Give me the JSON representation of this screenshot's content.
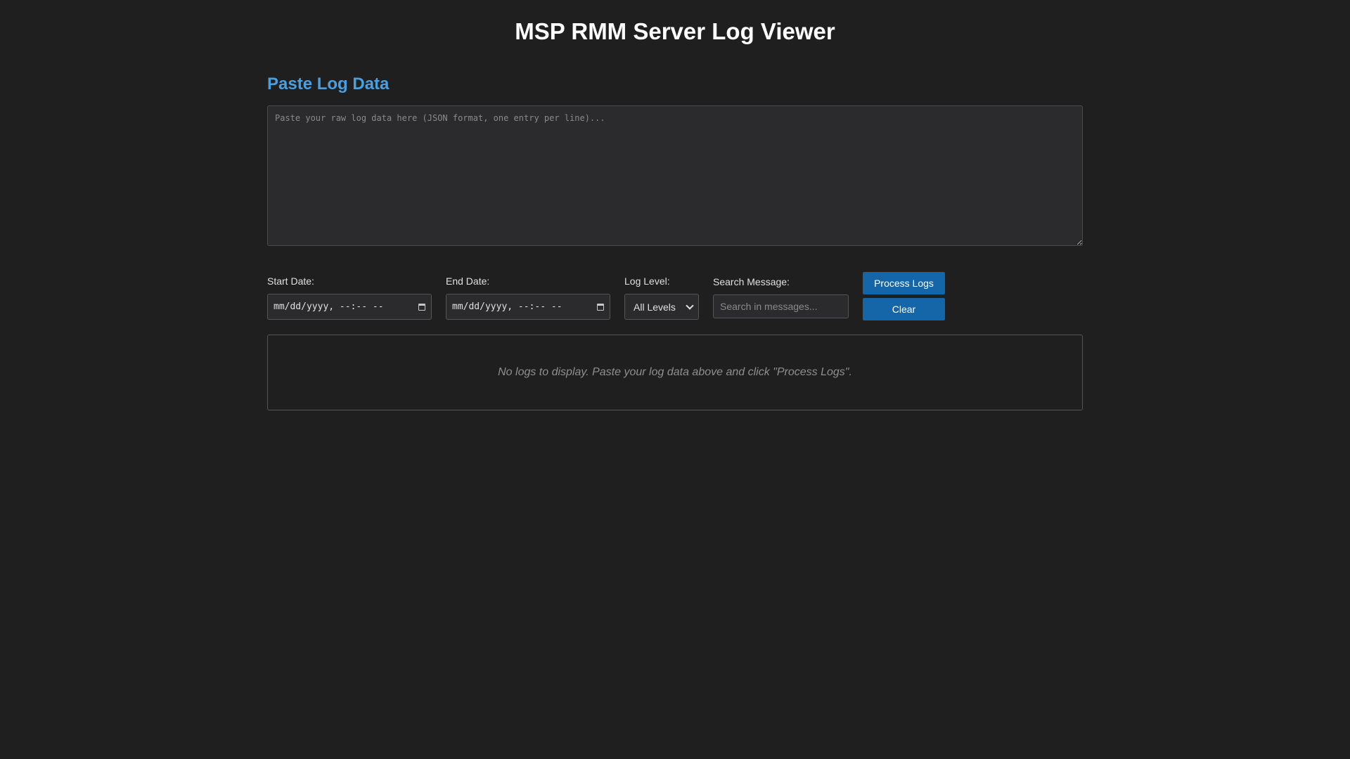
{
  "header": {
    "title": "MSP RMM Server Log Viewer"
  },
  "paste_section": {
    "heading": "Paste Log Data",
    "textarea_placeholder": "Paste your raw log data here (JSON format, one entry per line)...",
    "textarea_value": ""
  },
  "filters": {
    "start_date": {
      "label": "Start Date:",
      "value": "mm/dd/yyyy, --:-- --",
      "icon": "calendar-icon"
    },
    "end_date": {
      "label": "End Date:",
      "value": "mm/dd/yyyy, --:-- --",
      "icon": "calendar-icon"
    },
    "log_level": {
      "label": "Log Level:",
      "selected": "All Levels"
    },
    "search": {
      "label": "Search Message:",
      "placeholder": "Search in messages...",
      "value": ""
    }
  },
  "actions": {
    "process_label": "Process Logs",
    "clear_label": "Clear"
  },
  "log_display": {
    "empty_message": "No logs to display. Paste your log data above and click \"Process Logs\"."
  },
  "colors": {
    "background": "#1f1f1f",
    "accent": "#4a9fe0",
    "button": "#1466a8"
  }
}
